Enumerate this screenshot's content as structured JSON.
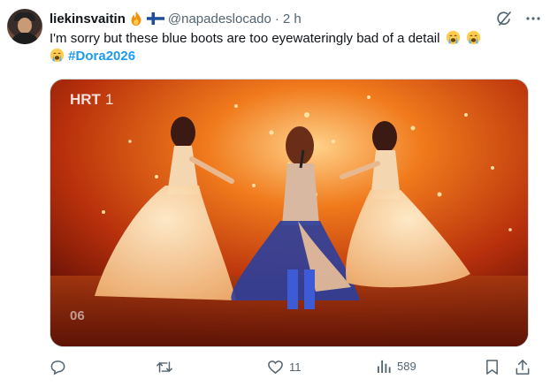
{
  "tweet": {
    "author_name": "liekinsvaitin",
    "author_flag_icons": [
      "fire-icon",
      "finland-flag-icon"
    ],
    "handle": "@napadeslocado",
    "separator": "·",
    "time": "2 h",
    "text_line": "I'm sorry but these blue boots are too eyewateringly bad of a detail",
    "hashtag": "#Dora2026",
    "emoji_icon": "loudly-crying-face-icon"
  },
  "media": {
    "broadcaster_logo": "HRT",
    "broadcaster_channel": "1",
    "entry_number": "06"
  },
  "actions": {
    "replies": "",
    "reposts": "",
    "likes": "11",
    "views": "589"
  },
  "colors": {
    "accent": "#1d9bf0",
    "secondary_text": "#536471",
    "stage_orange": "#e85a14"
  }
}
